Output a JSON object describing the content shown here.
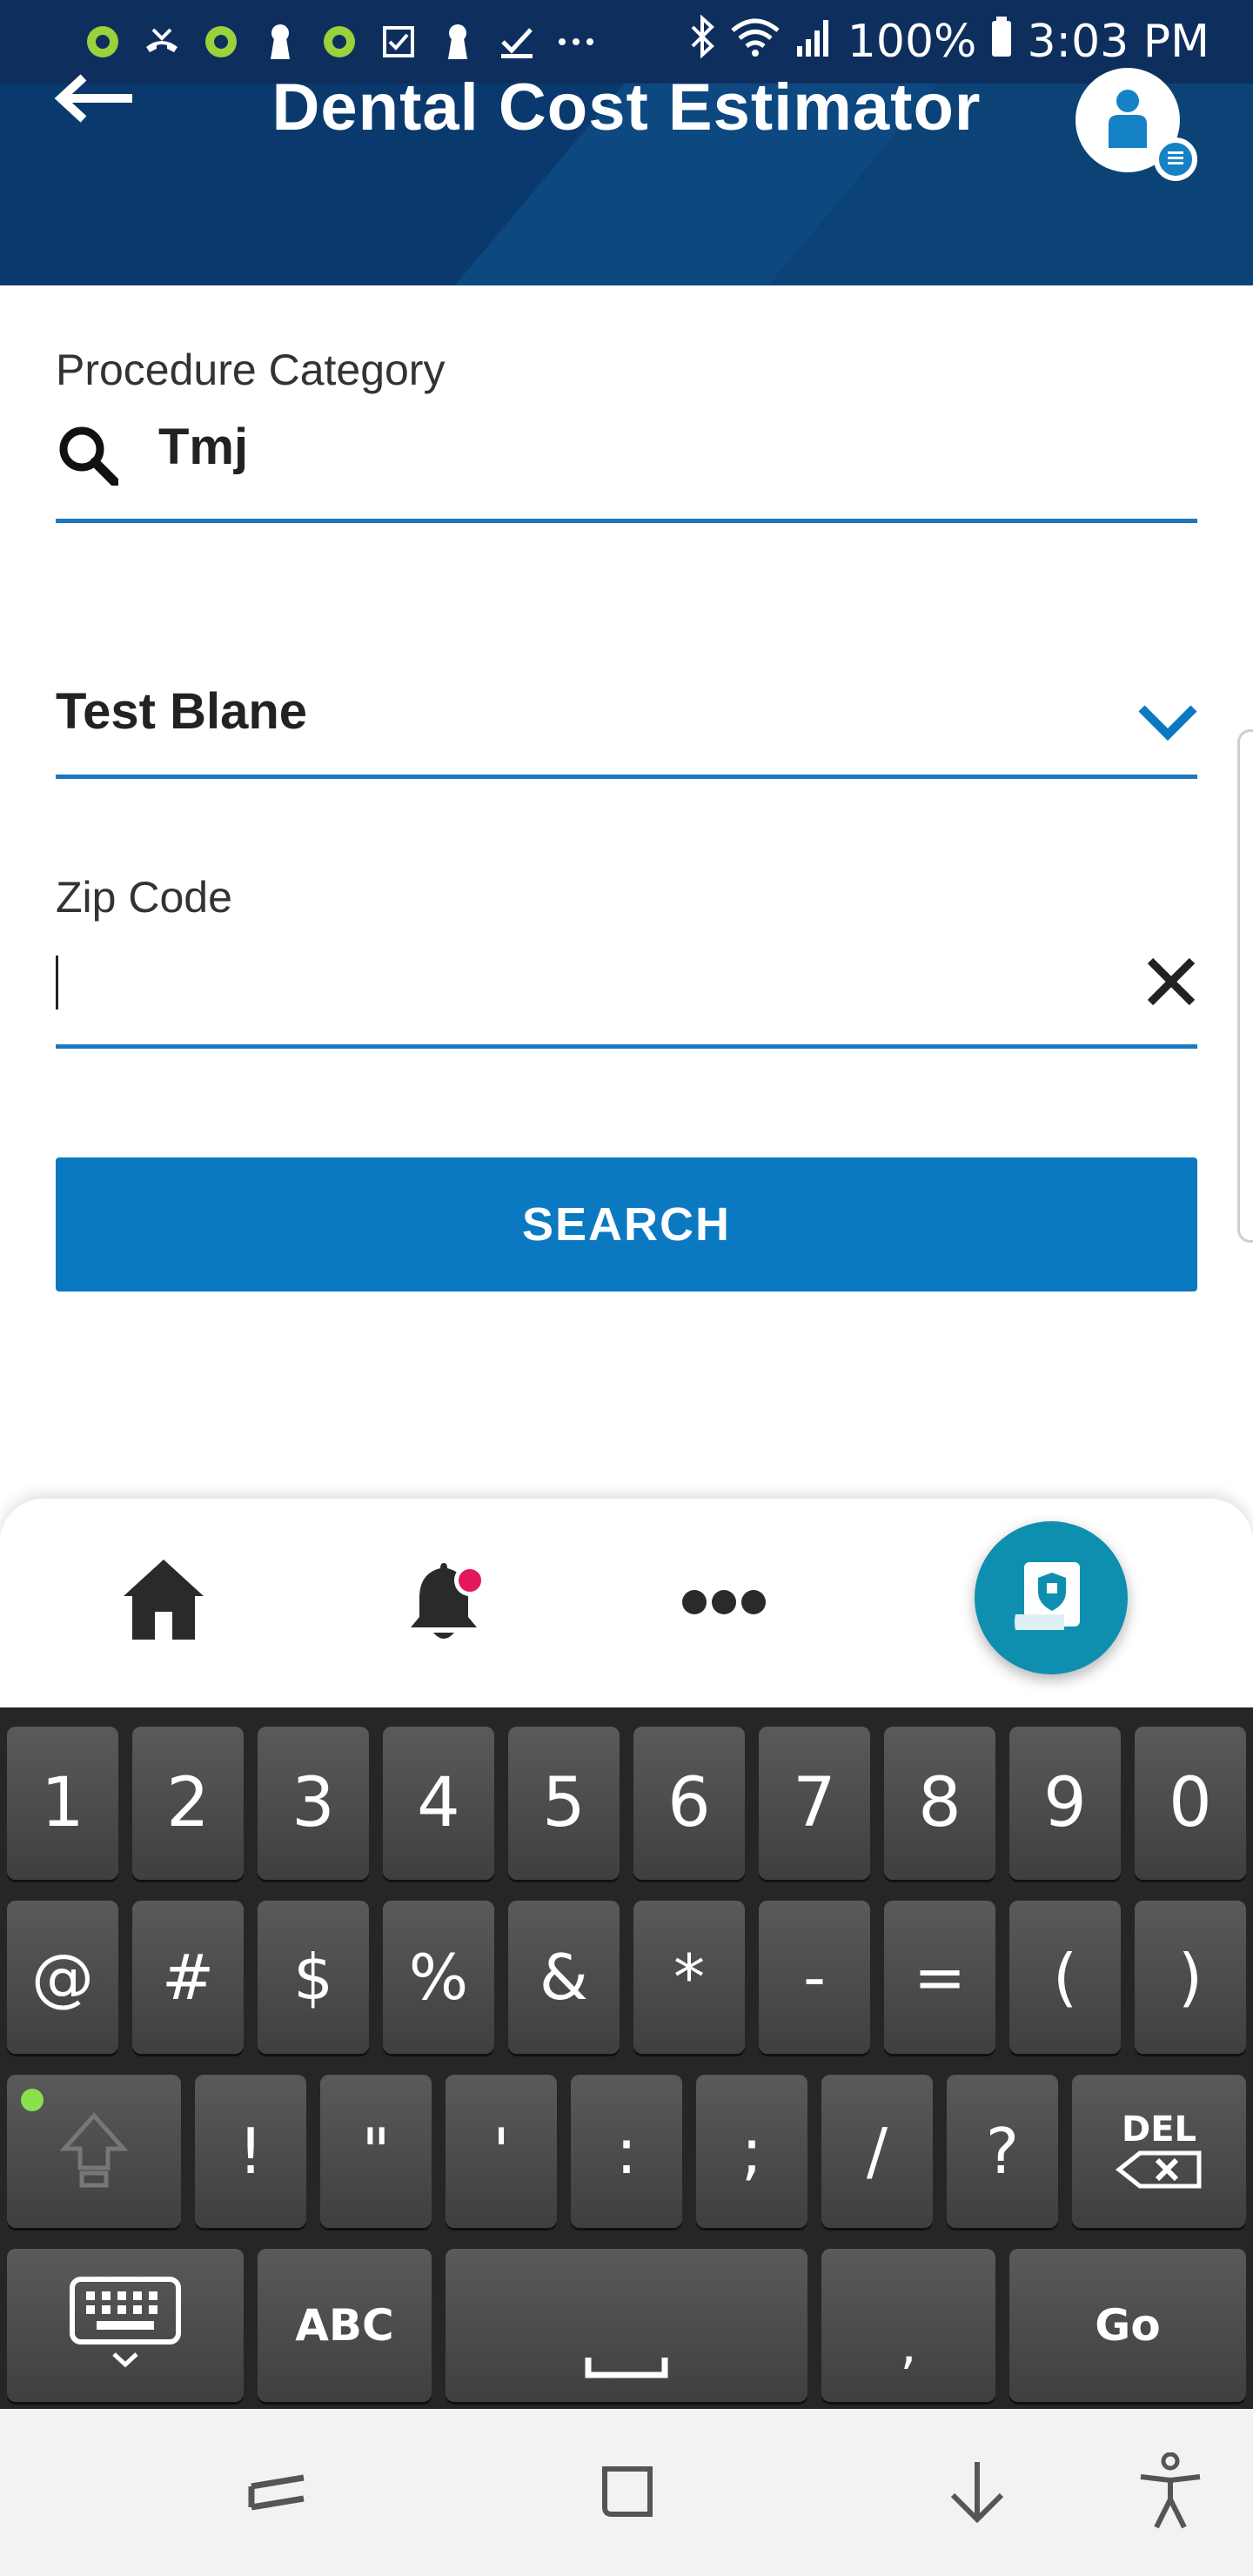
{
  "status_bar": {
    "battery": "100%",
    "time": "3:03 PM",
    "icons": [
      "app-icon",
      "missed-call-icon",
      "app-icon",
      "keyhole-icon",
      "app-icon",
      "checkbox-icon",
      "keyhole-icon",
      "download-done-icon",
      "more-icon",
      "bluetooth-icon",
      "wifi-icon",
      "signal-icon",
      "battery-icon"
    ]
  },
  "header": {
    "title": "Dental Cost Estimator",
    "back_icon": "arrow-left-icon",
    "avatar_icon": "user-icon"
  },
  "form": {
    "procedure_label": "Procedure Category",
    "procedure_value": "Tmj",
    "member_value": "Test Blane",
    "zip_label": "Zip Code",
    "zip_value": "",
    "search_label": "SEARCH"
  },
  "bottom_nav": {
    "items": [
      "home-icon",
      "bell-icon",
      "more-dots-icon",
      "id-card-shield-icon"
    ],
    "notification_dot_color": "#e3175c"
  },
  "keyboard": {
    "row1": [
      "1",
      "2",
      "3",
      "4",
      "5",
      "6",
      "7",
      "8",
      "9",
      "0"
    ],
    "row2": [
      "@",
      "#",
      "$",
      "%",
      "&",
      "*",
      "-",
      "=",
      "(",
      ")"
    ],
    "row3": [
      "!",
      "\"",
      "'",
      ":",
      ";",
      "/",
      "?"
    ],
    "del_label": "DEL",
    "abc_label": "ABC",
    "comma_label": ",",
    "go_label": "Go"
  },
  "colors": {
    "header_bg": "#0a3a6d",
    "accent": "#0a79c1",
    "fab": "#0f8fb0"
  }
}
